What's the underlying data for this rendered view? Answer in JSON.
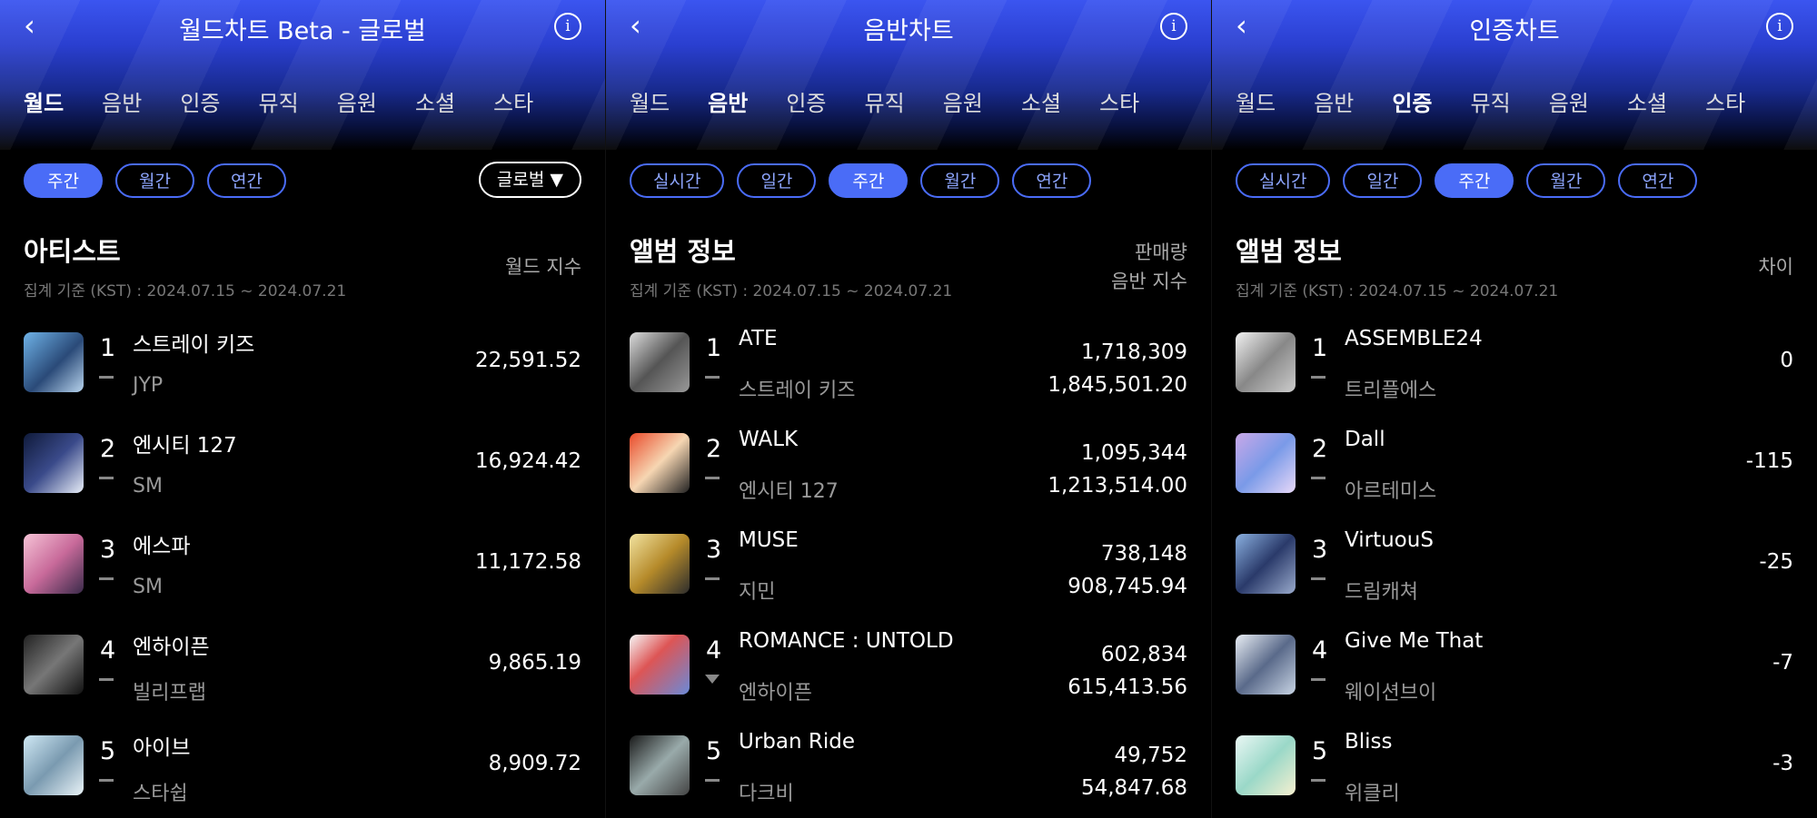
{
  "panels": [
    {
      "title": "월드차트 Beta - 글로벌",
      "tabs": [
        "월드",
        "음반",
        "인증",
        "뮤직",
        "음원",
        "소셜",
        "스타"
      ],
      "active_tab": 0,
      "pills": [
        "주간",
        "월간",
        "연간"
      ],
      "active_pill": 0,
      "dropdown": "글로벌 ▼",
      "section_title": "아티스트",
      "date": "집계 기준 (KST) : 2024.07.15 ~ 2024.07.21",
      "col_header": [
        "월드 지수"
      ],
      "rows": [
        {
          "rank": "1",
          "name": "스트레이 키즈",
          "sub": "JYP",
          "trend": "same",
          "values": [
            "22,591.52"
          ]
        },
        {
          "rank": "2",
          "name": "엔시티 127",
          "sub": "SM",
          "trend": "same",
          "values": [
            "16,924.42"
          ]
        },
        {
          "rank": "3",
          "name": "에스파",
          "sub": "SM",
          "trend": "same",
          "values": [
            "11,172.58"
          ]
        },
        {
          "rank": "4",
          "name": "엔하이픈",
          "sub": "빌리프랩",
          "trend": "same",
          "values": [
            "9,865.19"
          ]
        },
        {
          "rank": "5",
          "name": "아이브",
          "sub": "스타쉽",
          "trend": "same",
          "values": [
            "8,909.72"
          ]
        }
      ]
    },
    {
      "title": "음반차트",
      "tabs": [
        "월드",
        "음반",
        "인증",
        "뮤직",
        "음원",
        "소셜",
        "스타"
      ],
      "active_tab": 1,
      "pills": [
        "실시간",
        "일간",
        "주간",
        "월간",
        "연간"
      ],
      "active_pill": 2,
      "section_title": "앨범 정보",
      "date": "집계 기준 (KST) : 2024.07.15 ~ 2024.07.21",
      "col_header": [
        "판매량",
        "음반 지수"
      ],
      "rows": [
        {
          "rank": "1",
          "name": "ATE",
          "sub": "스트레이 키즈",
          "trend": "same",
          "values": [
            "1,718,309",
            "1,845,501.20"
          ]
        },
        {
          "rank": "2",
          "name": "WALK",
          "sub": "엔시티 127",
          "trend": "same",
          "values": [
            "1,095,344",
            "1,213,514.00"
          ]
        },
        {
          "rank": "3",
          "name": "MUSE",
          "sub": "지민",
          "trend": "same",
          "values": [
            "738,148",
            "908,745.94"
          ]
        },
        {
          "rank": "4",
          "name": "ROMANCE : UNTOLD",
          "sub": "엔하이픈",
          "trend": "down",
          "values": [
            "602,834",
            "615,413.56"
          ]
        },
        {
          "rank": "5",
          "name": "Urban Ride",
          "sub": "다크비",
          "trend": "same",
          "values": [
            "49,752",
            "54,847.68"
          ]
        }
      ]
    },
    {
      "title": "인증차트",
      "tabs": [
        "월드",
        "음반",
        "인증",
        "뮤직",
        "음원",
        "소셜",
        "스타"
      ],
      "active_tab": 2,
      "pills": [
        "실시간",
        "일간",
        "주간",
        "월간",
        "연간"
      ],
      "active_pill": 2,
      "section_title": "앨범 정보",
      "date": "집계 기준 (KST) : 2024.07.15 ~ 2024.07.21",
      "col_header": [
        "차이"
      ],
      "rows": [
        {
          "rank": "1",
          "name": "ASSEMBLE24",
          "sub": "트리플에스",
          "trend": "same",
          "values": [
            "0"
          ]
        },
        {
          "rank": "2",
          "name": "Dall",
          "sub": "아르테미스",
          "trend": "same",
          "values": [
            "-115"
          ]
        },
        {
          "rank": "3",
          "name": "VirtuouS",
          "sub": "드림캐쳐",
          "trend": "same",
          "values": [
            "-25"
          ]
        },
        {
          "rank": "4",
          "name": "Give Me That",
          "sub": "웨이션브이",
          "trend": "same",
          "values": [
            "-7"
          ]
        },
        {
          "rank": "5",
          "name": "Bliss",
          "sub": "위클리",
          "trend": "same",
          "values": [
            "-3"
          ]
        }
      ]
    }
  ],
  "icons": {
    "back": "back-chevron-icon",
    "info": "info-icon"
  },
  "colors": {
    "accent": "#4a6cf7",
    "header_gradient": "#3b55f0",
    "background": "#000000"
  }
}
